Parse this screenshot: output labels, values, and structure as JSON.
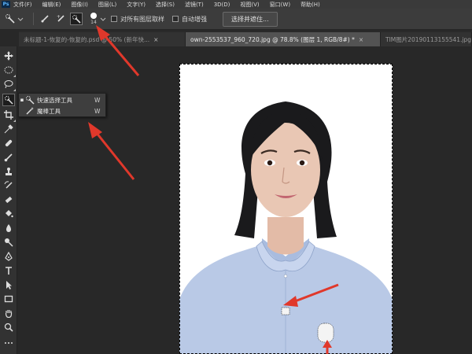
{
  "app": {
    "logo": "Ps"
  },
  "menu": [
    "文件(F)",
    "编辑(E)",
    "图像(I)",
    "图层(L)",
    "文字(Y)",
    "选择(S)",
    "滤镜(T)",
    "3D(D)",
    "视图(V)",
    "窗口(W)",
    "帮助(H)"
  ],
  "options": {
    "brush_size": "14",
    "sample_all_layers": "对所有图层取样",
    "auto_enhance": "自动增强",
    "select_subject": "选择并遮住..."
  },
  "tabs": [
    {
      "label": "未标题-1-恢复的-恢复的.psd @ 50% (新年快...",
      "close": "×"
    },
    {
      "label": "own-2553537_960_720.jpg @ 78.8% (图层 1, RGB/8#) *",
      "close": "×"
    },
    {
      "label": "TIM图片20190113155541.jpg",
      "close": ""
    }
  ],
  "flyout": {
    "items": [
      {
        "bullet": "▪",
        "label": "快速选择工具",
        "key": "W",
        "icon": "quick-selection-icon"
      },
      {
        "bullet": "",
        "label": "魔棒工具",
        "key": "W",
        "icon": "magic-wand-icon"
      }
    ]
  },
  "tools": [
    "move-icon",
    "marquee-icon",
    "lasso-icon",
    "quick-selection-icon",
    "crop-icon",
    "eyedropper-icon",
    "healing-icon",
    "brush-icon",
    "stamp-icon",
    "history-brush-icon",
    "eraser-icon",
    "bucket-icon",
    "blur-icon",
    "dodge-icon",
    "pen-icon",
    "type-icon",
    "path-select-icon",
    "rectangle-icon",
    "hand-icon",
    "zoom-icon"
  ],
  "colors": {
    "accent_arrow": "#e0382b",
    "shirt": "#b9c9e6",
    "hair": "#1a1a1c",
    "skin": "#e9c7b4"
  }
}
